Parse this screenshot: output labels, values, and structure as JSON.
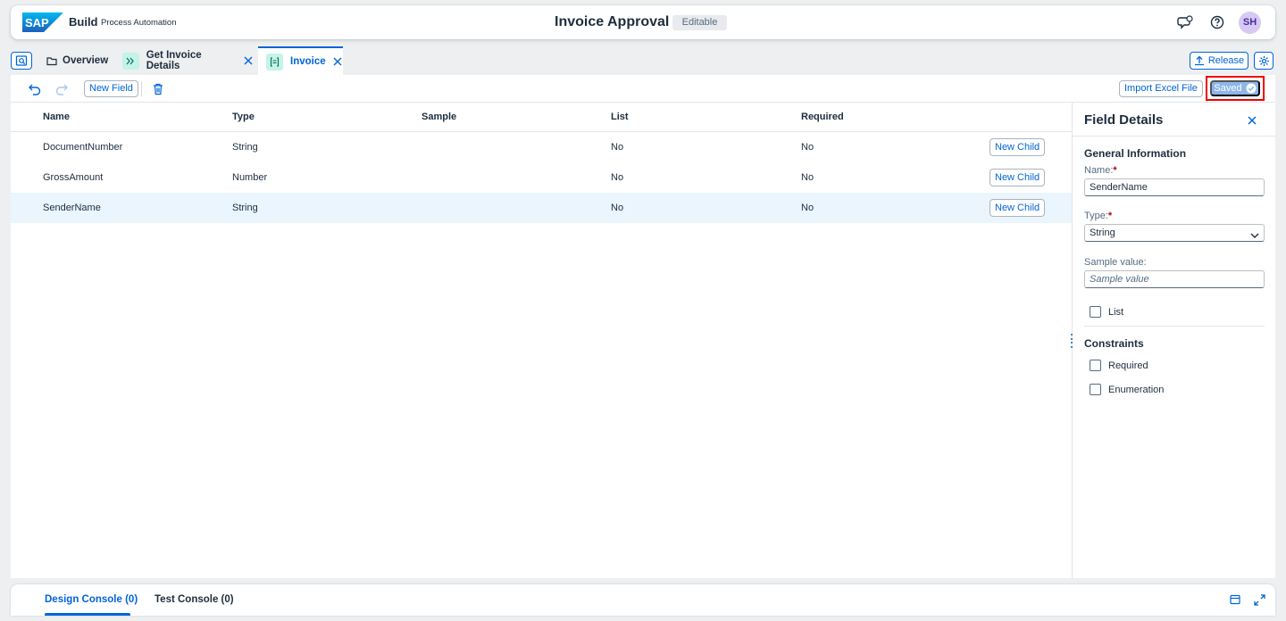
{
  "shell": {
    "brand": "SAP",
    "app_name": "Build",
    "app_sub": "Process Automation",
    "title": "Invoice Approval",
    "status_badge": "Editable",
    "avatar_initials": "SH"
  },
  "tabs": {
    "items": [
      {
        "label": "Overview",
        "icon": "folder-icon"
      },
      {
        "label": "Get Invoice Details",
        "icon": "chevrons-right-icon"
      },
      {
        "label": "Invoice",
        "icon": "data-type-icon"
      }
    ],
    "release_label": "Release"
  },
  "toolbar": {
    "new_field_label": "New Field",
    "import_label": "Import Excel File",
    "saved_label": "Saved"
  },
  "table": {
    "columns": [
      "Name",
      "Type",
      "Sample",
      "List",
      "Required"
    ],
    "rows": [
      {
        "name": "DocumentNumber",
        "type": "String",
        "sample": "",
        "list": "No",
        "required": "No",
        "action": "New Child"
      },
      {
        "name": "GrossAmount",
        "type": "Number",
        "sample": "",
        "list": "No",
        "required": "No",
        "action": "New Child"
      },
      {
        "name": "SenderName",
        "type": "String",
        "sample": "",
        "list": "No",
        "required": "No",
        "action": "New Child"
      }
    ]
  },
  "details": {
    "title": "Field Details",
    "general_title": "General Information",
    "name_label": "Name:",
    "name_value": "SenderName",
    "type_label": "Type:",
    "type_value": "String",
    "sample_label": "Sample value:",
    "sample_placeholder": "Sample value",
    "list_label": "List",
    "constraints_title": "Constraints",
    "required_label": "Required",
    "enumeration_label": "Enumeration",
    "required_marker": "*"
  },
  "console": {
    "design_label": "Design Console (0)",
    "test_label": "Test Console (0)"
  },
  "colors": {
    "accent": "#0064d9",
    "sap_blue": "#0070f2",
    "highlight_frame": "#ee0000",
    "selected_row": "#eaf5fe"
  }
}
